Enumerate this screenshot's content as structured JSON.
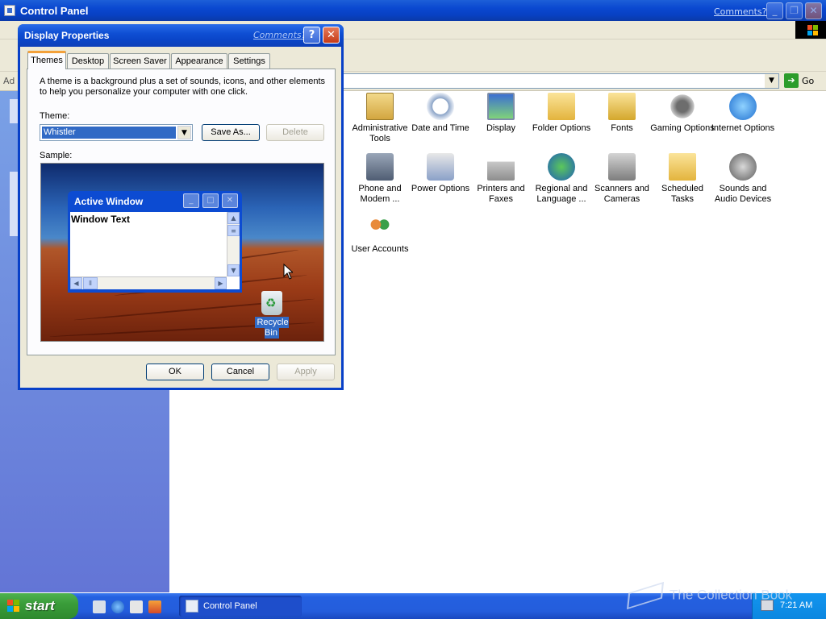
{
  "window": {
    "title": "Control Panel",
    "comments_link": "Comments?"
  },
  "address_bar": {
    "label": "Ad",
    "go_label": "Go"
  },
  "control_panel_items": [
    {
      "label": "Administrative Tools",
      "icon": "admin-tools-icon"
    },
    {
      "label": "Date and Time",
      "icon": "date-time-icon"
    },
    {
      "label": "Display",
      "icon": "display-icon"
    },
    {
      "label": "Folder Options",
      "icon": "folder-options-icon"
    },
    {
      "label": "Fonts",
      "icon": "fonts-icon"
    },
    {
      "label": "Gaming Options",
      "icon": "gaming-options-icon"
    },
    {
      "label": "Internet Options",
      "icon": "internet-options-icon"
    },
    {
      "label": "Phone and Modem ...",
      "icon": "phone-modem-icon"
    },
    {
      "label": "Power Options",
      "icon": "power-options-icon"
    },
    {
      "label": "Printers and Faxes",
      "icon": "printers-faxes-icon"
    },
    {
      "label": "Regional and Language ...",
      "icon": "regional-language-icon"
    },
    {
      "label": "Scanners and Cameras",
      "icon": "scanners-cameras-icon"
    },
    {
      "label": "Scheduled Tasks",
      "icon": "scheduled-tasks-icon"
    },
    {
      "label": "Sounds and Audio Devices",
      "icon": "sounds-audio-icon"
    },
    {
      "label": "User Accounts",
      "icon": "user-accounts-icon"
    }
  ],
  "dialog": {
    "title": "Display Properties",
    "comments_link": "Comments?",
    "tabs": [
      "Themes",
      "Desktop",
      "Screen Saver",
      "Appearance",
      "Settings"
    ],
    "active_tab": "Themes",
    "description": "A theme is a background plus a set of sounds, icons, and other elements to help you personalize your computer with one click.",
    "theme_label": "Theme:",
    "theme_value": "Whistler",
    "save_as_label": "Save As...",
    "delete_label": "Delete",
    "sample_label": "Sample:",
    "sample": {
      "active_window_title": "Active Window",
      "window_text": "Window Text",
      "recycle_bin_label": "Recycle Bin"
    },
    "ok_label": "OK",
    "cancel_label": "Cancel",
    "apply_label": "Apply"
  },
  "taskbar": {
    "start_label": "start",
    "task_label": "Control Panel",
    "clock": "7:21 AM"
  },
  "watermark": "The Collection Book",
  "colors": {
    "titlebar_blue": "#0a48d0",
    "start_green": "#3a9d3a",
    "dialog_face": "#ece9d8",
    "selection_blue": "#316ac5"
  }
}
